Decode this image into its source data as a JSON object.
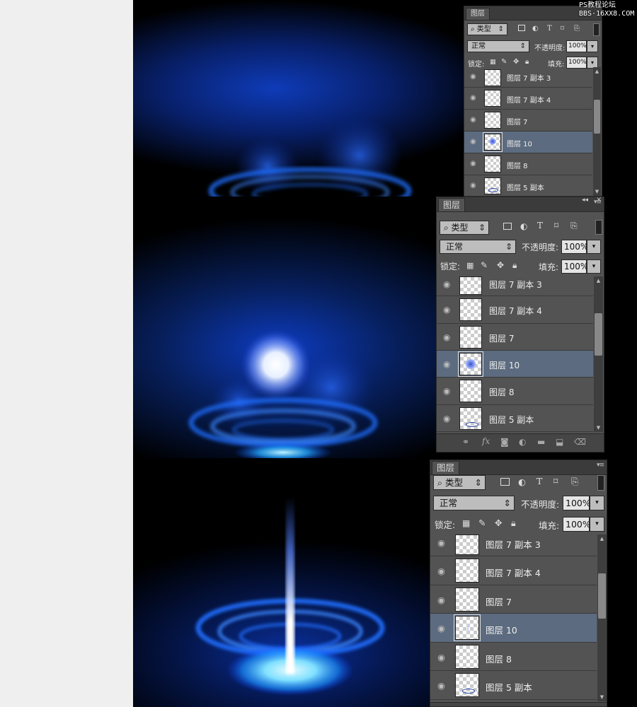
{
  "watermark": {
    "line1": "PS教程论坛",
    "line2": "BBS·16XX8.COM"
  },
  "panels": [
    {
      "tab": "图层",
      "filter": "类型",
      "blend_mode": "正常",
      "opacity_label": "不透明度:",
      "opacity_value": "100%",
      "lock_label": "锁定:",
      "fill_label": "填充:",
      "fill_value": "100%",
      "collapse_arrows": "◂◂",
      "close_x": "×",
      "layers": [
        {
          "name": "图层 7 副本 3",
          "selected": false
        },
        {
          "name": "图层 7 副本 4",
          "selected": false
        },
        {
          "name": "图层 7",
          "selected": false
        },
        {
          "name": "图层 10",
          "selected": true
        },
        {
          "name": "图层 8",
          "selected": false
        },
        {
          "name": "图层 5 副本",
          "selected": false
        }
      ]
    },
    {
      "tab": "图层",
      "filter": "类型",
      "blend_mode": "正常",
      "opacity_label": "不透明度:",
      "opacity_value": "100%",
      "lock_label": "锁定:",
      "fill_label": "填充:",
      "fill_value": "100%",
      "layers": [
        {
          "name": "图层 7 副本 3",
          "selected": false
        },
        {
          "name": "图层 7 副本 4",
          "selected": false
        },
        {
          "name": "图层 7",
          "selected": false
        },
        {
          "name": "图层 10",
          "selected": true
        },
        {
          "name": "图层 8",
          "selected": false
        },
        {
          "name": "图层 5 副本",
          "selected": false
        }
      ],
      "bottom_icons": [
        "link-icon",
        "fx-icon",
        "mask-icon",
        "adjustment-icon",
        "folder-icon",
        "new-layer-icon",
        "trash-icon"
      ]
    },
    {
      "tab": "图层",
      "filter": "类型",
      "blend_mode": "正常",
      "opacity_label": "不透明度:",
      "opacity_value": "100%",
      "lock_label": "锁定:",
      "fill_label": "填充:",
      "fill_value": "100%",
      "layers": [
        {
          "name": "图层 7 副本 3",
          "selected": false
        },
        {
          "name": "图层 7 副本 4",
          "selected": false
        },
        {
          "name": "图层 7",
          "selected": false
        },
        {
          "name": "图层 10",
          "selected": true
        },
        {
          "name": "图层 8",
          "selected": false
        },
        {
          "name": "图层 5 副本",
          "selected": false
        }
      ]
    }
  ],
  "colors": {
    "panel_bg": "#535353",
    "selected_row": "#5c6b7f",
    "glow_blue": "#1f6fff",
    "glow_cyan": "#7fe0ff"
  }
}
